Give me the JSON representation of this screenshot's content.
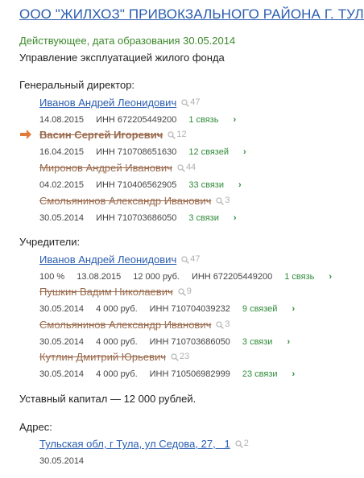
{
  "company": {
    "title": "ООО \"ЖИЛХОЗ\" ПРИВОКЗАЛЬНОГО РАЙОНА Г. ТУЛЫ",
    "status": "Действующее, дата образования 30.05.2014",
    "activity": "Управление эксплуатацией жилого фонда"
  },
  "directors": {
    "label": "Генеральный директор:",
    "items": [
      {
        "name": "Иванов Андрей Леонидович",
        "count": "47",
        "date": "14.08.2015",
        "inn": "ИНН 672205449200",
        "links": "1 связь",
        "style": "link"
      },
      {
        "name": "Васин Сергей Игоревич",
        "count": "12",
        "date": "16.04.2015",
        "inn": "ИНН 710708651630",
        "links": "12 связей",
        "style": "current"
      },
      {
        "name": "Миронов Андрей Иванович",
        "count": "44",
        "date": "04.02.2015",
        "inn": "ИНН 710406562905",
        "links": "33 связи",
        "style": "struck"
      },
      {
        "name": "Смольянинов Александр Иванович",
        "count": "3",
        "date": "30.05.2014",
        "inn": "ИНН 710703686050",
        "links": "3 связи",
        "style": "struck"
      }
    ]
  },
  "founders": {
    "label": "Учредители:",
    "items": [
      {
        "name": "Иванов Андрей Леонидович",
        "count": "47",
        "share": "100 %",
        "date": "13.08.2015",
        "amount": "12 000 руб.",
        "inn": "ИНН 672205449200",
        "links": "1 связь",
        "style": "link"
      },
      {
        "name": "Пушкин Вадим Николаевич",
        "count": "9",
        "date": "30.05.2014",
        "amount": "4 000 руб.",
        "inn": "ИНН 710704039232",
        "links": "9 связей",
        "style": "struck"
      },
      {
        "name": "Смольянинов Александр Иванович",
        "count": "3",
        "date": "30.05.2014",
        "amount": "4 000 руб.",
        "inn": "ИНН 710703686050",
        "links": "3 связи",
        "style": "struck"
      },
      {
        "name": "Кутлин Дмитрий Юрьевич",
        "count": "23",
        "date": "30.05.2014",
        "amount": "4 000 руб.",
        "inn": "ИНН 710506982999",
        "links": "23 связи",
        "style": "struck"
      }
    ]
  },
  "capital": "Уставный капитал — 12 000 рублей.",
  "address": {
    "label": "Адрес:",
    "value": "Тульская обл, г Тула, ул Седова, 27,   1",
    "count": "2",
    "date": "30.05.2014"
  },
  "icons": {
    "chevron": "›",
    "search": "search-icon",
    "arrow": "arrow-right-icon"
  },
  "colors": {
    "link": "#2a5db0",
    "struck": "#9a6b4e",
    "status_green": "#3c8a2c",
    "connections": "#2e8b3a",
    "arrow": "#e07b39"
  }
}
